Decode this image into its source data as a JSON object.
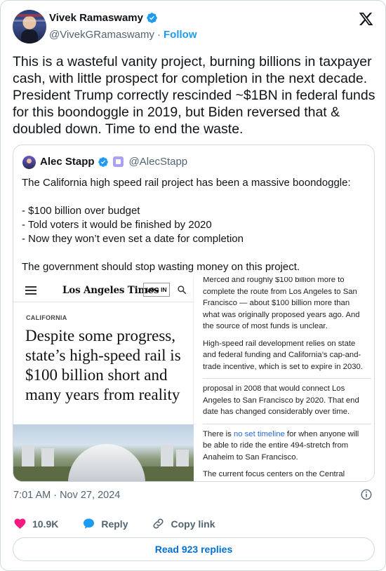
{
  "author": {
    "name": "Vivek Ramaswamy",
    "handle": "@VivekGRamaswamy",
    "separator": "·",
    "follow_label": "Follow"
  },
  "tweet_text": "This is a wasteful vanity project, burning billions in taxpayer cash, with little prospect for completion in the next decade. President Trump correctly rescinded ~$1BN in federal funds for this boondoggle in 2019, but Biden reversed that & doubled down. Time to end the waste.",
  "quote": {
    "name": "Alec Stapp",
    "handle": "@AlecStapp",
    "text": "The California high speed rail project has been a massive boondoggle:\n\n- $100 billion over budget\n- Told voters it would be finished by 2020\n- Now they won’t even set a date for completion\n\nThe government should stop wasting money on this project.",
    "image": {
      "masthead": "Los Angeles Times",
      "login_label": "LOG IN",
      "section": "CALIFORNIA",
      "headline": "Despite some progress, state’s high-speed rail is $100 billion short and many years from reality",
      "article": {
        "p1": "Merced and roughly $100 billion more to complete the route from Los Angeles to San Francisco — about $100 billion more than what was originally proposed years ago. And the source of most funds is unclear.",
        "p2": "High-speed rail development relies on state and federal funding and California’s cap-and-trade incentive, which is set to expire in 2030.",
        "p3": "proposal in 2008 that would connect Los Angeles to San Francisco by 2020. That end date has changed considerably over time.",
        "p4_pre": "There is ",
        "p4_link": "no set timeline",
        "p4_post": " for when anyone will be able to ride the entire 494-stretch from Anaheim to San Francisco.",
        "p5": "The current focus centers on the Central"
      }
    }
  },
  "timestamp": "7:01 AM · Nov 27, 2024",
  "actions": {
    "likes": "10.9K",
    "reply_label": "Reply",
    "copy_link_label": "Copy link"
  },
  "read_replies_label": "Read 923 replies",
  "colors": {
    "accent": "#1d9bf0",
    "like_red": "#f91880",
    "muted": "#536471",
    "link": "#006fd6"
  },
  "icons": [
    "verified-badge-icon",
    "x-logo-icon",
    "hamburger-menu-icon",
    "search-icon",
    "info-icon",
    "heart-icon",
    "reply-bubble-icon",
    "link-icon"
  ]
}
